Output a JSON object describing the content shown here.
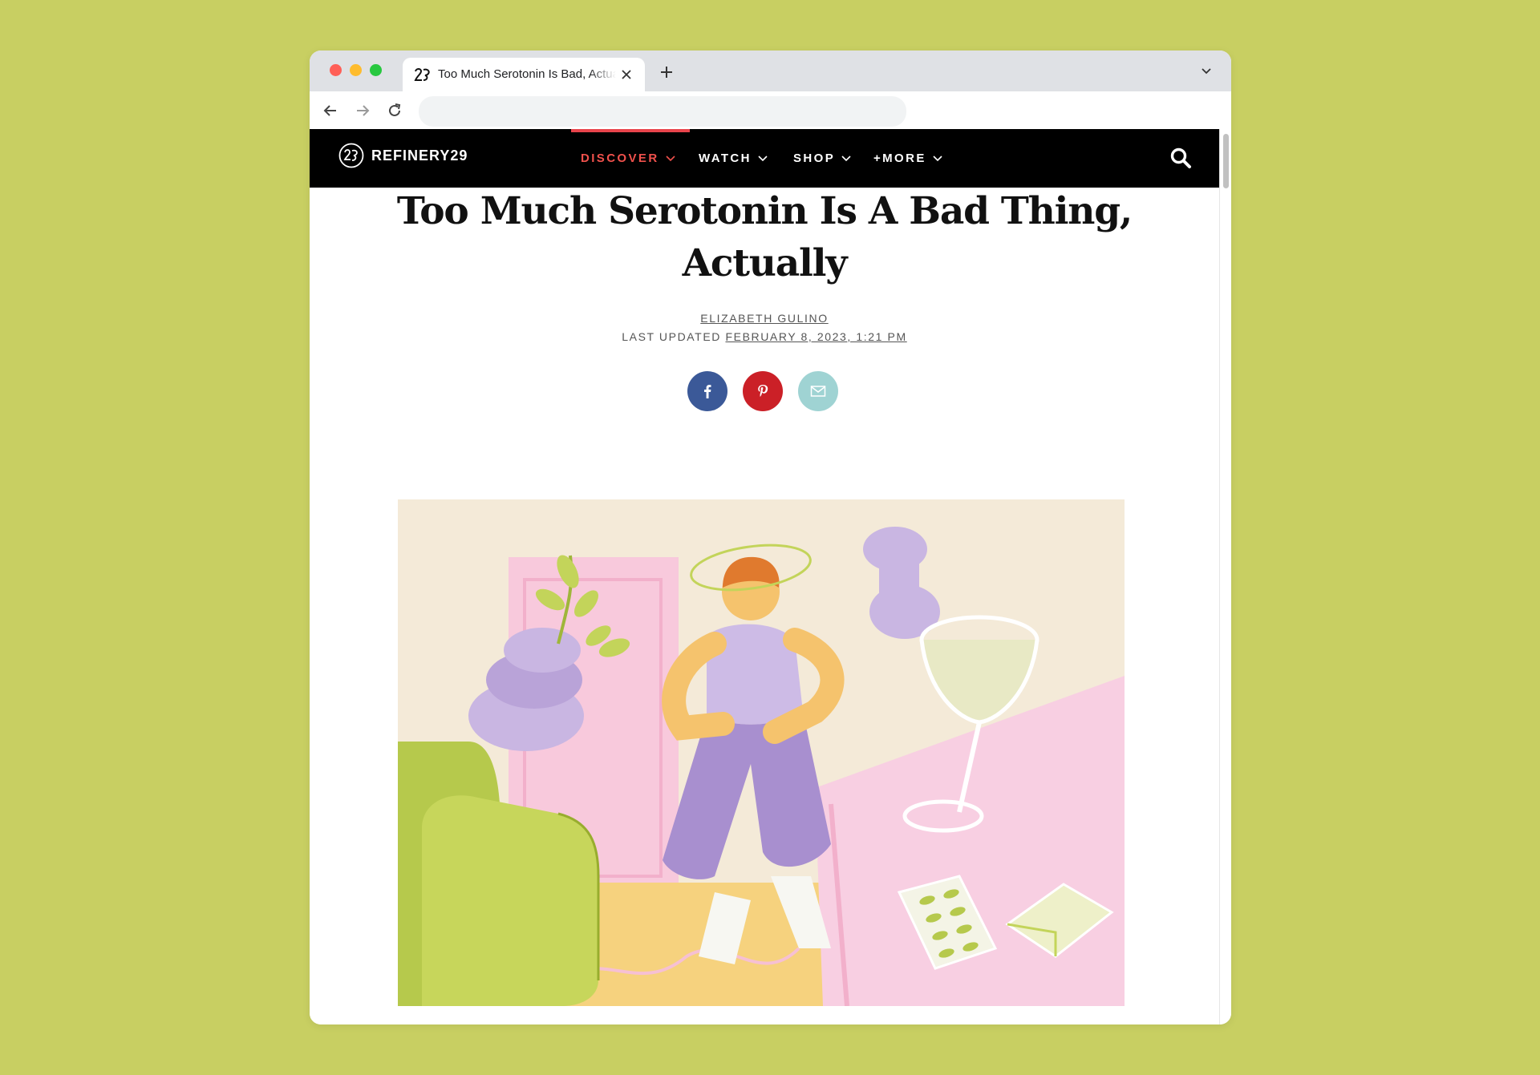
{
  "browser": {
    "tab_title": "Too Much Serotonin Is Bad, Actually",
    "address_placeholder": ""
  },
  "site": {
    "logo_text": "REFINERY29",
    "nav": [
      {
        "label": "DISCOVER",
        "active": true
      },
      {
        "label": "WATCH",
        "active": false
      },
      {
        "label": "SHOP",
        "active": false
      },
      {
        "label": "+MORE",
        "active": false
      }
    ]
  },
  "article": {
    "headline_line1": "Too Much Serotonin Is A Bad Thing,",
    "headline_line2": "Actually",
    "author": "ELIZABETH GULINO",
    "updated_prefix": "LAST UPDATED",
    "updated_date": "FEBRUARY 8, 2023, 1:21 PM"
  },
  "share": [
    "facebook-icon",
    "pinterest-icon",
    "email-icon"
  ],
  "colors": {
    "page_background": "#c8cf62",
    "nav_background": "#000000",
    "nav_active": "#f0514c",
    "facebook": "#3b5998",
    "pinterest": "#cb2027",
    "email": "#9fd3d3"
  }
}
